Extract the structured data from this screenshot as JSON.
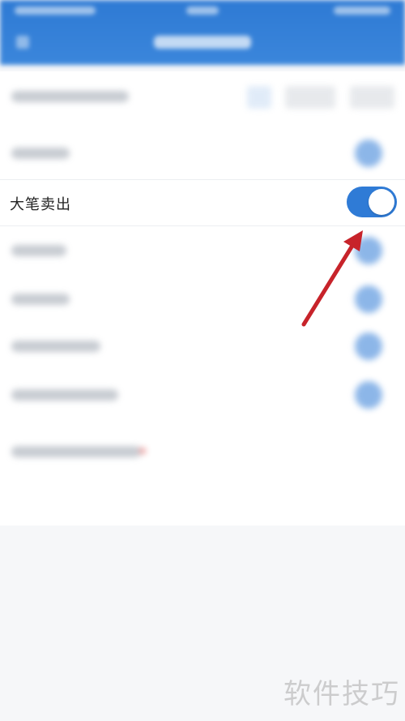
{
  "settings": {
    "highlighted_row": {
      "label": "大笔卖出",
      "toggle_on": true
    }
  },
  "colors": {
    "header_blue": "#2e7ad4",
    "toggle_blue": "#2f7bd6",
    "arrow_red": "#c7232a"
  },
  "annotation": {
    "arrow": "red-arrow-pointing-to-toggle"
  },
  "watermark": "软件技巧"
}
